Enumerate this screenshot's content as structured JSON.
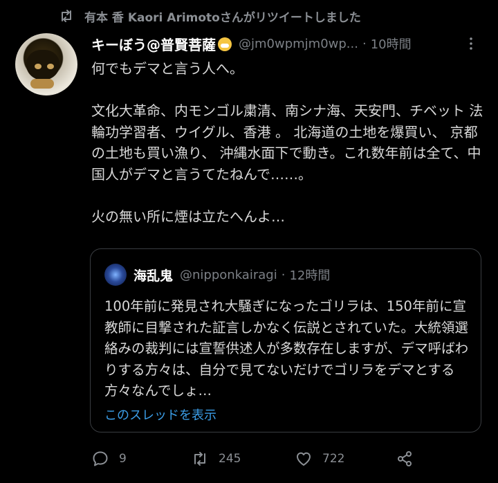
{
  "retweet_header": {
    "text": "有本 香 Kaori Arimotoさんがリツイートしました",
    "icon": "retweet-icon"
  },
  "tweet": {
    "display_name": "キーぼう@普賢菩薩",
    "emoji_icon": "grimacing-face-emoji",
    "handle": "@jm0wpmjm0wp...",
    "dot": "·",
    "time": "10時間",
    "text": "何でもデマと言う人へ。\n\n文化大革命、内モンゴル粛清、南シナ海、天安門、チベット 法輪功学習者、ウイグル、香港 。 北海道の土地を爆買い、 京都の土地も買い漁り、 沖縄水面下で動き。これ数年前は全て、中国人がデマと言うてたねんで……。\n\n火の無い所に煙は立たへんよ…"
  },
  "quote": {
    "display_name": "海乱鬼",
    "handle": "@nipponkairagi",
    "dot": "·",
    "time": "12時間",
    "text": "100年前に発見され大騒ぎになったゴリラは、150年前に宣教師に目撃された証言しかなく伝説とされていた。大統領選絡みの裁判には宣誓供述人が多数存在しますが、デマ呼ばわりする方々は、自分で見てないだけでゴリラをデマとする方々なんでしょ…",
    "show_thread": "このスレッドを表示"
  },
  "actions": {
    "reply_count": "9",
    "retweet_count": "245",
    "like_count": "722"
  },
  "colors": {
    "background": "#000000",
    "text": "#d9d9d9",
    "muted": "#7c8086",
    "link": "#3b9ee8",
    "border": "#3a3d41"
  }
}
